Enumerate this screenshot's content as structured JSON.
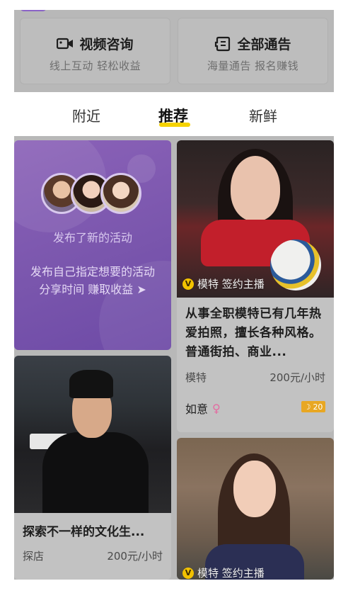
{
  "services": [
    {
      "icon": "video-camera-icon",
      "title": "视频咨询",
      "subtitle": "线上互动 轻松收益"
    },
    {
      "icon": "notice-icon",
      "title": "全部通告",
      "subtitle": "海量通告 报名赚钱"
    }
  ],
  "tabs": [
    {
      "label": "附近",
      "active": false
    },
    {
      "label": "推荐",
      "active": true
    },
    {
      "label": "新鲜",
      "active": false
    }
  ],
  "promo": {
    "title": "发布了新的活动",
    "line1": "发布自己指定想要的活动",
    "line2": "分享时间 赚取收益 ➤"
  },
  "cards": [
    {
      "badge": "V",
      "badge_text": "模特 签约主播",
      "description": "从事全职模特已有几年热爱拍照，擅长各种风格。普通街拍、商业...",
      "category": "模特",
      "price": "200元/小时",
      "owner": "如意",
      "gender_icon": "female-icon",
      "level": "20"
    },
    {
      "description": "探索不一样的文化生...",
      "category": "探店",
      "price": "200元/小时"
    },
    {
      "badge": "V",
      "badge_text": "模特 签约主播"
    }
  ],
  "colors": {
    "accent": "#f5d200",
    "promo": "#7a56ad",
    "badge": "#f2c200",
    "level": "#e8a723"
  }
}
